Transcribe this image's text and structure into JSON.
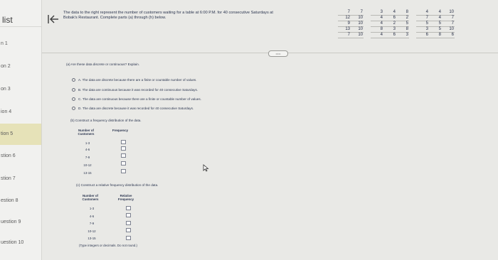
{
  "sidebar": {
    "header": "list",
    "items": [
      {
        "label": "n 1"
      },
      {
        "label": "on 2"
      },
      {
        "label": "on 3"
      },
      {
        "label": "ion 4"
      },
      {
        "label": "tion 5"
      },
      {
        "label": "stion 6"
      },
      {
        "label": "stion 7"
      },
      {
        "label": "estion 8"
      },
      {
        "label": "uestion 9"
      },
      {
        "label": "uestion 10"
      }
    ]
  },
  "question": {
    "prompt": "The data to the right represent the number of customers waiting for a table at 6:00 P.M. for 40 consecutive Saturdays at Bobak's Restaurant. Complete parts (a) through (h) below.",
    "expand_label": "•••••",
    "data_rows": [
      [
        "7",
        "7",
        "3",
        "4",
        "8",
        "4",
        "4",
        "10"
      ],
      [
        "12",
        "10",
        "4",
        "6",
        "2",
        "7",
        "4",
        "7"
      ],
      [
        "9",
        "10",
        "4",
        "2",
        "5",
        "5",
        "5",
        "7"
      ],
      [
        "13",
        "10",
        "8",
        "3",
        "8",
        "3",
        "5",
        "10"
      ],
      [
        "7",
        "10",
        "4",
        "6",
        "3",
        "6",
        "8",
        "6"
      ]
    ],
    "part_a": {
      "label": "(a) Are these data discrete or continuous? Explain.",
      "choices": [
        {
          "letter": "A.",
          "text": "The data are discrete because there are a finite or countable number of values."
        },
        {
          "letter": "B.",
          "text": "The data are continuous because it was recorded for 40 consecutive Saturdays."
        },
        {
          "letter": "C.",
          "text": "The data are continuous because there are a finite or countable number of values."
        },
        {
          "letter": "D.",
          "text": "The data are discrete because it was recorded for 40 consecutive Saturdays."
        }
      ]
    },
    "part_b": {
      "label": "(b) Construct a frequency distribution of the data.",
      "col1": "Number of Customers",
      "col2": "Frequency",
      "rows": [
        "1-3",
        "4-6",
        "7-9",
        "10-12",
        "13-15"
      ]
    },
    "part_c": {
      "label": "(c) Construct a relative frequency distribution of the data.",
      "col1": "Number of Customers",
      "col2": "Relative Frequency",
      "rows": [
        "1-3",
        "4-6",
        "7-9",
        "10-12",
        "13-15"
      ],
      "note": "(Type integers or decimals. Do not round.)"
    }
  }
}
